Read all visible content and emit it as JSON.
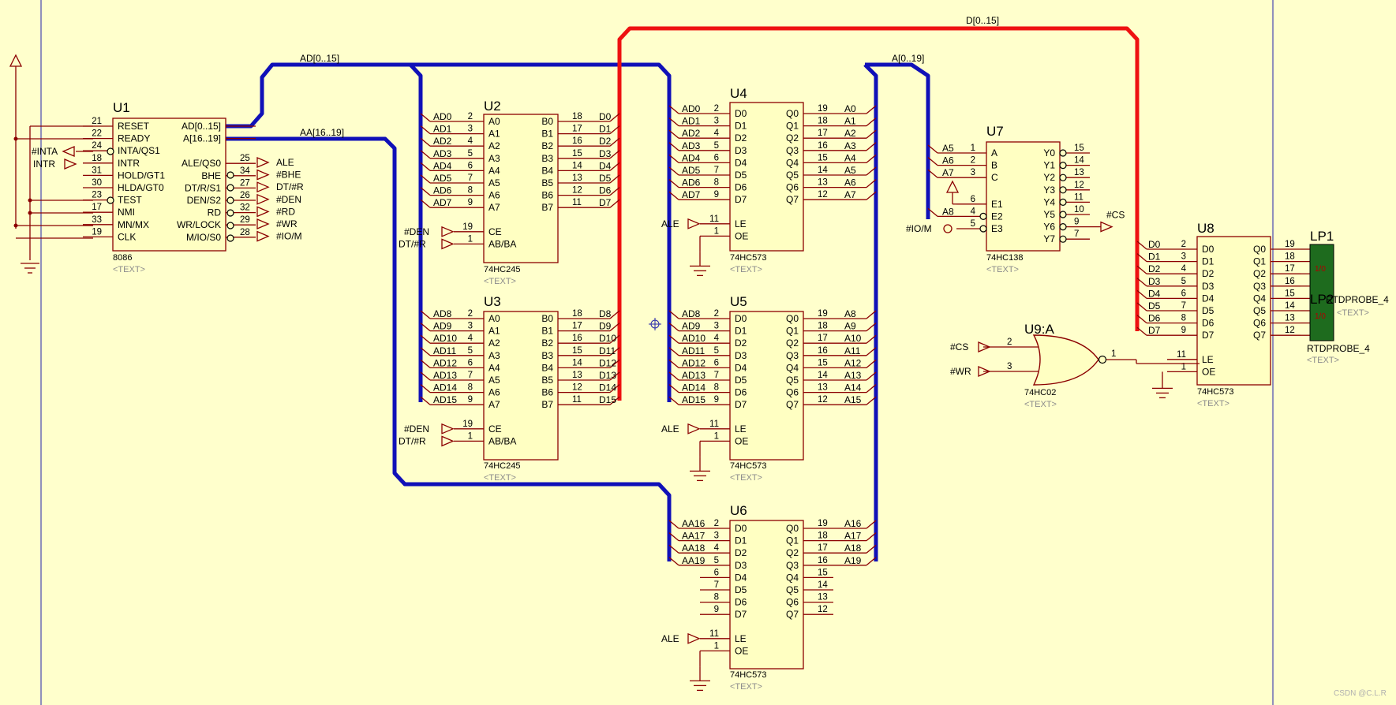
{
  "chips": [
    {
      "ref": "U1",
      "type": "8086",
      "text": "<TEXT>",
      "left_pins": [
        {
          "n": "21",
          "l": "RESET"
        },
        {
          "n": "22",
          "l": "READY"
        },
        {
          "n": "24",
          "l": "INTA/QS1"
        },
        {
          "n": "18",
          "l": "INTR"
        },
        {
          "n": "31",
          "l": "HOLD/GT1"
        },
        {
          "n": "30",
          "l": "HLDA/GT0"
        },
        {
          "n": "23",
          "l": "TEST"
        },
        {
          "n": "17",
          "l": "NMI"
        },
        {
          "n": "33",
          "l": "MN/MX"
        },
        {
          "n": "19",
          "l": "CLK"
        }
      ],
      "right_pins": [
        {
          "n": "",
          "l": "AD[0..15]"
        },
        {
          "n": "",
          "l": "A[16..19]"
        },
        {
          "n": "25",
          "l": "ALE/QS0"
        },
        {
          "n": "34",
          "l": "BHE"
        },
        {
          "n": "27",
          "l": "DT/R/S1"
        },
        {
          "n": "26",
          "l": "DEN/S2"
        },
        {
          "n": "32",
          "l": "RD"
        },
        {
          "n": "29",
          "l": "WR/LOCK"
        },
        {
          "n": "28",
          "l": "M/IO/S0"
        }
      ]
    },
    {
      "ref": "U2",
      "type": "74HC245",
      "text": "<TEXT>",
      "left_pins": [
        {
          "n": "2",
          "l": "A0"
        },
        {
          "n": "3",
          "l": "A1"
        },
        {
          "n": "4",
          "l": "A2"
        },
        {
          "n": "5",
          "l": "A3"
        },
        {
          "n": "6",
          "l": "A4"
        },
        {
          "n": "7",
          "l": "A5"
        },
        {
          "n": "8",
          "l": "A6"
        },
        {
          "n": "9",
          "l": "A7"
        },
        {
          "n": "19",
          "l": "CE"
        },
        {
          "n": "1",
          "l": "AB/BA"
        }
      ],
      "right_pins": [
        {
          "n": "18",
          "l": "B0"
        },
        {
          "n": "17",
          "l": "B1"
        },
        {
          "n": "16",
          "l": "B2"
        },
        {
          "n": "15",
          "l": "B3"
        },
        {
          "n": "14",
          "l": "B4"
        },
        {
          "n": "13",
          "l": "B5"
        },
        {
          "n": "12",
          "l": "B6"
        },
        {
          "n": "11",
          "l": "B7"
        }
      ]
    },
    {
      "ref": "U3",
      "type": "74HC245",
      "text": "<TEXT>",
      "left_pins": [
        {
          "n": "2",
          "l": "A0"
        },
        {
          "n": "3",
          "l": "A1"
        },
        {
          "n": "4",
          "l": "A2"
        },
        {
          "n": "5",
          "l": "A3"
        },
        {
          "n": "6",
          "l": "A4"
        },
        {
          "n": "7",
          "l": "A5"
        },
        {
          "n": "8",
          "l": "A6"
        },
        {
          "n": "9",
          "l": "A7"
        },
        {
          "n": "19",
          "l": "CE"
        },
        {
          "n": "1",
          "l": "AB/BA"
        }
      ],
      "right_pins": [
        {
          "n": "18",
          "l": "B0"
        },
        {
          "n": "17",
          "l": "B1"
        },
        {
          "n": "16",
          "l": "B2"
        },
        {
          "n": "15",
          "l": "B3"
        },
        {
          "n": "14",
          "l": "B4"
        },
        {
          "n": "13",
          "l": "B5"
        },
        {
          "n": "12",
          "l": "B6"
        },
        {
          "n": "11",
          "l": "B7"
        }
      ]
    },
    {
      "ref": "U4",
      "type": "74HC573",
      "text": "<TEXT>",
      "left_pins": [
        {
          "n": "2",
          "l": "D0"
        },
        {
          "n": "3",
          "l": "D1"
        },
        {
          "n": "4",
          "l": "D2"
        },
        {
          "n": "5",
          "l": "D3"
        },
        {
          "n": "6",
          "l": "D4"
        },
        {
          "n": "7",
          "l": "D5"
        },
        {
          "n": "8",
          "l": "D6"
        },
        {
          "n": "9",
          "l": "D7"
        },
        {
          "n": "11",
          "l": "LE"
        },
        {
          "n": "1",
          "l": "OE"
        }
      ],
      "right_pins": [
        {
          "n": "19",
          "l": "Q0"
        },
        {
          "n": "18",
          "l": "Q1"
        },
        {
          "n": "17",
          "l": "Q2"
        },
        {
          "n": "16",
          "l": "Q3"
        },
        {
          "n": "15",
          "l": "Q4"
        },
        {
          "n": "14",
          "l": "Q5"
        },
        {
          "n": "13",
          "l": "Q6"
        },
        {
          "n": "12",
          "l": "Q7"
        }
      ]
    },
    {
      "ref": "U5",
      "type": "74HC573",
      "text": "<TEXT>",
      "left_pins": [
        {
          "n": "2",
          "l": "D0"
        },
        {
          "n": "3",
          "l": "D1"
        },
        {
          "n": "4",
          "l": "D2"
        },
        {
          "n": "5",
          "l": "D3"
        },
        {
          "n": "6",
          "l": "D4"
        },
        {
          "n": "7",
          "l": "D5"
        },
        {
          "n": "8",
          "l": "D6"
        },
        {
          "n": "9",
          "l": "D7"
        },
        {
          "n": "11",
          "l": "LE"
        },
        {
          "n": "1",
          "l": "OE"
        }
      ],
      "right_pins": [
        {
          "n": "19",
          "l": "Q0"
        },
        {
          "n": "18",
          "l": "Q1"
        },
        {
          "n": "17",
          "l": "Q2"
        },
        {
          "n": "16",
          "l": "Q3"
        },
        {
          "n": "15",
          "l": "Q4"
        },
        {
          "n": "14",
          "l": "Q5"
        },
        {
          "n": "13",
          "l": "Q6"
        },
        {
          "n": "12",
          "l": "Q7"
        }
      ]
    },
    {
      "ref": "U6",
      "type": "74HC573",
      "text": "<TEXT>",
      "left_pins": [
        {
          "n": "2",
          "l": "D0"
        },
        {
          "n": "3",
          "l": "D1"
        },
        {
          "n": "4",
          "l": "D2"
        },
        {
          "n": "5",
          "l": "D3"
        },
        {
          "n": "6",
          "l": "D4"
        },
        {
          "n": "7",
          "l": "D5"
        },
        {
          "n": "8",
          "l": "D6"
        },
        {
          "n": "9",
          "l": "D7"
        },
        {
          "n": "11",
          "l": "LE"
        },
        {
          "n": "1",
          "l": "OE"
        }
      ],
      "right_pins": [
        {
          "n": "19",
          "l": "Q0"
        },
        {
          "n": "18",
          "l": "Q1"
        },
        {
          "n": "17",
          "l": "Q2"
        },
        {
          "n": "16",
          "l": "Q3"
        },
        {
          "n": "15",
          "l": "Q4"
        },
        {
          "n": "14",
          "l": "Q5"
        },
        {
          "n": "13",
          "l": "Q6"
        },
        {
          "n": "12",
          "l": "Q7"
        }
      ]
    },
    {
      "ref": "U7",
      "type": "74HC138",
      "text": "<TEXT>",
      "left_pins": [
        {
          "n": "1",
          "l": "A"
        },
        {
          "n": "2",
          "l": "B"
        },
        {
          "n": "3",
          "l": "C"
        },
        {
          "n": "6",
          "l": "E1"
        },
        {
          "n": "4",
          "l": "E2"
        },
        {
          "n": "5",
          "l": "E3"
        }
      ],
      "right_pins": [
        {
          "n": "15",
          "l": "Y0"
        },
        {
          "n": "14",
          "l": "Y1"
        },
        {
          "n": "13",
          "l": "Y2"
        },
        {
          "n": "12",
          "l": "Y3"
        },
        {
          "n": "11",
          "l": "Y4"
        },
        {
          "n": "10",
          "l": "Y5"
        },
        {
          "n": "9",
          "l": "Y6"
        },
        {
          "n": "7",
          "l": "Y7"
        }
      ]
    },
    {
      "ref": "U8",
      "type": "74HC573",
      "text": "<TEXT>",
      "left_pins": [
        {
          "n": "2",
          "l": "D0"
        },
        {
          "n": "3",
          "l": "D1"
        },
        {
          "n": "4",
          "l": "D2"
        },
        {
          "n": "5",
          "l": "D3"
        },
        {
          "n": "6",
          "l": "D4"
        },
        {
          "n": "7",
          "l": "D5"
        },
        {
          "n": "8",
          "l": "D6"
        },
        {
          "n": "9",
          "l": "D7"
        },
        {
          "n": "11",
          "l": "LE"
        },
        {
          "n": "1",
          "l": "OE"
        }
      ],
      "right_pins": [
        {
          "n": "19",
          "l": "Q0"
        },
        {
          "n": "18",
          "l": "Q1"
        },
        {
          "n": "17",
          "l": "Q2"
        },
        {
          "n": "16",
          "l": "Q3"
        },
        {
          "n": "15",
          "l": "Q4"
        },
        {
          "n": "14",
          "l": "Q5"
        },
        {
          "n": "13",
          "l": "Q6"
        },
        {
          "n": "12",
          "l": "Q7"
        }
      ]
    }
  ],
  "gate": {
    "ref": "U9:A",
    "type": "74HC02",
    "text": "<TEXT>",
    "in1_pin": "2",
    "in2_pin": "3",
    "out_pin": "1"
  },
  "probes": {
    "lp1": "LP1",
    "lp2": "LP2",
    "value": "1/0",
    "probe1": "RTDPROBE_4",
    "probe2": "RTDPROBE_4",
    "hidden_text": "<TEXT>"
  },
  "bus_labels": {
    "ad": "AD[0..15]",
    "aa": "AA[16..19]",
    "d": "D[0..15]",
    "a": "A[0..19]"
  },
  "u1_left_nets": {
    "inta": "#INTA",
    "intr": "INTR"
  },
  "u1_right_nets": [
    "ALE",
    "#BHE",
    "DT/#R",
    "#DEN",
    "#RD",
    "#WR",
    "#IO/M"
  ],
  "u2_in": [
    "AD0",
    "AD1",
    "AD2",
    "AD3",
    "AD4",
    "AD5",
    "AD6",
    "AD7"
  ],
  "u2_out": [
    "D0",
    "D1",
    "D2",
    "D3",
    "D4",
    "D5",
    "D6",
    "D7"
  ],
  "u3_in": [
    "AD8",
    "AD9",
    "AD10",
    "AD11",
    "AD12",
    "AD13",
    "AD14",
    "AD15"
  ],
  "u3_out": [
    "D8",
    "D9",
    "D10",
    "D11",
    "D12",
    "D13",
    "D14",
    "D15"
  ],
  "u4_in": [
    "AD0",
    "AD1",
    "AD2",
    "AD3",
    "AD4",
    "AD5",
    "AD6",
    "AD7"
  ],
  "u4_out": [
    "A0",
    "A1",
    "A2",
    "A3",
    "A4",
    "A5",
    "A6",
    "A7"
  ],
  "u5_in": [
    "AD8",
    "AD9",
    "AD10",
    "AD11",
    "AD12",
    "AD13",
    "AD14",
    "AD15"
  ],
  "u5_out": [
    "A8",
    "A9",
    "A10",
    "A11",
    "A12",
    "A13",
    "A14",
    "A15"
  ],
  "u6_in": [
    "AA16",
    "AA17",
    "AA18",
    "AA19"
  ],
  "u6_out": [
    "A16",
    "A17",
    "A18",
    "A19"
  ],
  "u7_in": [
    "A5",
    "A6",
    "A7",
    "A8"
  ],
  "u8_in": [
    "D0",
    "D1",
    "D2",
    "D3",
    "D4",
    "D5",
    "D6",
    "D7"
  ],
  "ctl_nets": {
    "den": "#DEN",
    "dtr": "DT/#R",
    "ale": "ALE",
    "cs": "#CS",
    "iom": "#IO/M",
    "wr": "#WR"
  },
  "watermark": "CSDN @C.L.R",
  "colors": {
    "wire": "#8b0000",
    "bus": "#1010b8",
    "dbus": "#ee1111",
    "chip_fill": "#ffffc2",
    "chip_border": "#8b0000",
    "background": "#ffffcc",
    "probe": "#1e6b1e"
  }
}
